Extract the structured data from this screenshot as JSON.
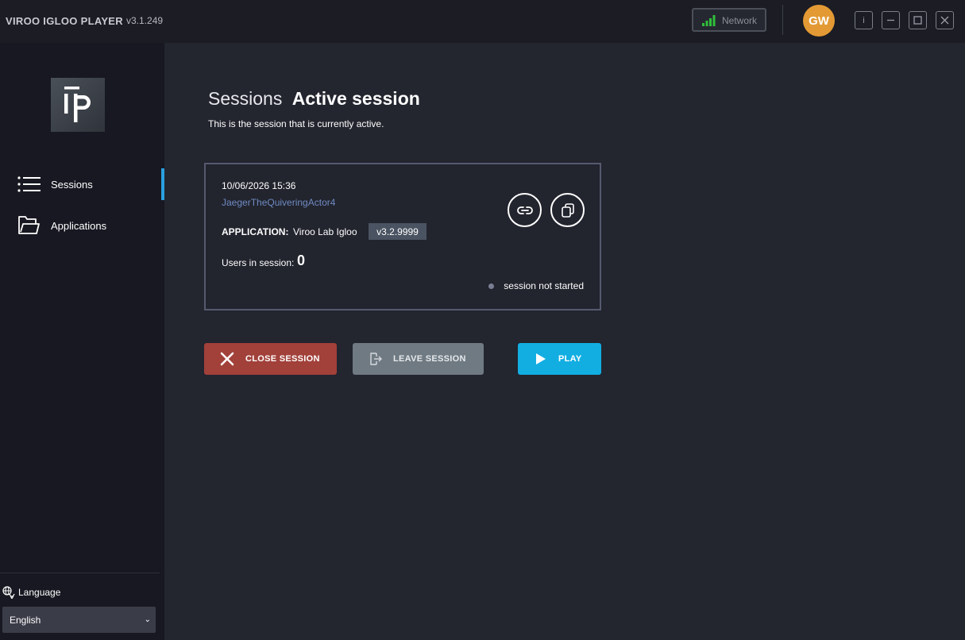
{
  "titlebar": {
    "app_name": "VIROO IGLOO PLAYER",
    "version": "v3.1.249",
    "network_label": "Network",
    "user_initials": "GW",
    "info_label": "i",
    "colors": {
      "network_bars": "#2fbf3a",
      "avatar": "#e39a34"
    }
  },
  "sidebar": {
    "items": [
      {
        "label": "Sessions",
        "icon": "list-icon",
        "active": true
      },
      {
        "label": "Applications",
        "icon": "folder-icon",
        "active": false
      }
    ],
    "language": {
      "label": "Language",
      "selected": "English"
    },
    "accent": "#2aa0e0"
  },
  "main": {
    "breadcrumb": "Sessions",
    "title": "Active session",
    "subtitle": "This is the session that is currently active.",
    "session": {
      "date": "10/06/2026 15:36",
      "name": "JaegerTheQuiveringActor4",
      "application_label": "APPLICATION:",
      "application_name": "Viroo Lab Igloo",
      "application_version": "v3.2.9999",
      "users_label": "Users in session:",
      "users_count": "0",
      "status": "session not started"
    },
    "actions": {
      "close_label": "CLOSE SESSION",
      "leave_label": "LEAVE SESSION",
      "play_label": "PLAY"
    },
    "colors": {
      "close": "#a2403a",
      "leave": "#6f7a82",
      "play": "#12aee2"
    }
  }
}
